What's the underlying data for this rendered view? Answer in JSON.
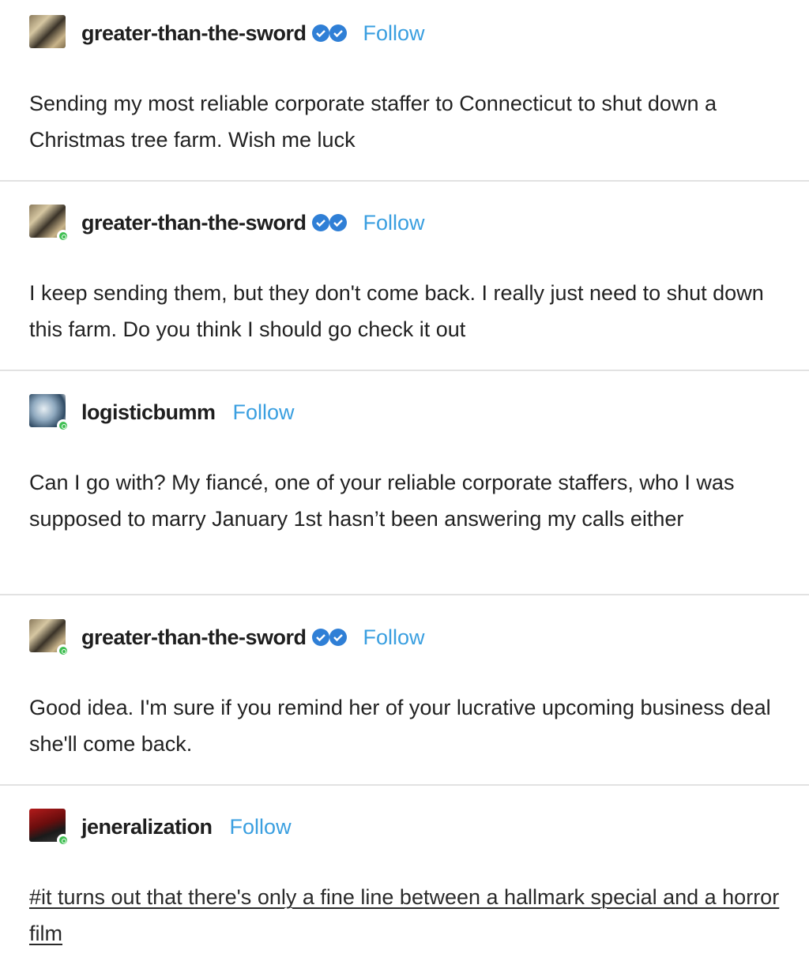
{
  "posts": [
    {
      "username": "greater-than-the-sword",
      "verified": true,
      "online": false,
      "follow_label": "Follow",
      "avatar_icon": "sword-blog-avatar",
      "text": "Sending my most reliable corporate staffer to Connecticut to shut down a Christmas tree farm. Wish me luck"
    },
    {
      "username": "greater-than-the-sword",
      "verified": true,
      "online": true,
      "follow_label": "Follow",
      "avatar_icon": "sword-blog-avatar",
      "text": "I keep sending them, but they don't come back. I really just need to shut down this farm. Do you think I should go check it out"
    },
    {
      "username": "logisticbumm",
      "verified": false,
      "online": true,
      "follow_label": "Follow",
      "avatar_icon": "logisticbumm-avatar",
      "text": "Can I go with? My fiancé, one of your reliable corporate staffers, who I was supposed to marry January 1st hasn’t been answering my calls either"
    },
    {
      "username": "greater-than-the-sword",
      "verified": true,
      "online": true,
      "follow_label": "Follow",
      "avatar_icon": "sword-blog-avatar",
      "text": "Good idea. I'm sure if you remind her of your lucrative upcoming business deal she'll come back."
    },
    {
      "username": "jeneralization",
      "verified": false,
      "online": true,
      "follow_label": "Follow",
      "avatar_icon": "jeneralization-avatar",
      "tags": "#it turns out that there's only a fine line between a hallmark special and a horror film"
    }
  ],
  "colors": {
    "follow": "#3a9fe0",
    "verified_badge": "#2f7fd6",
    "online_dot": "#3fbf52",
    "separator": "#e2e2e2"
  }
}
